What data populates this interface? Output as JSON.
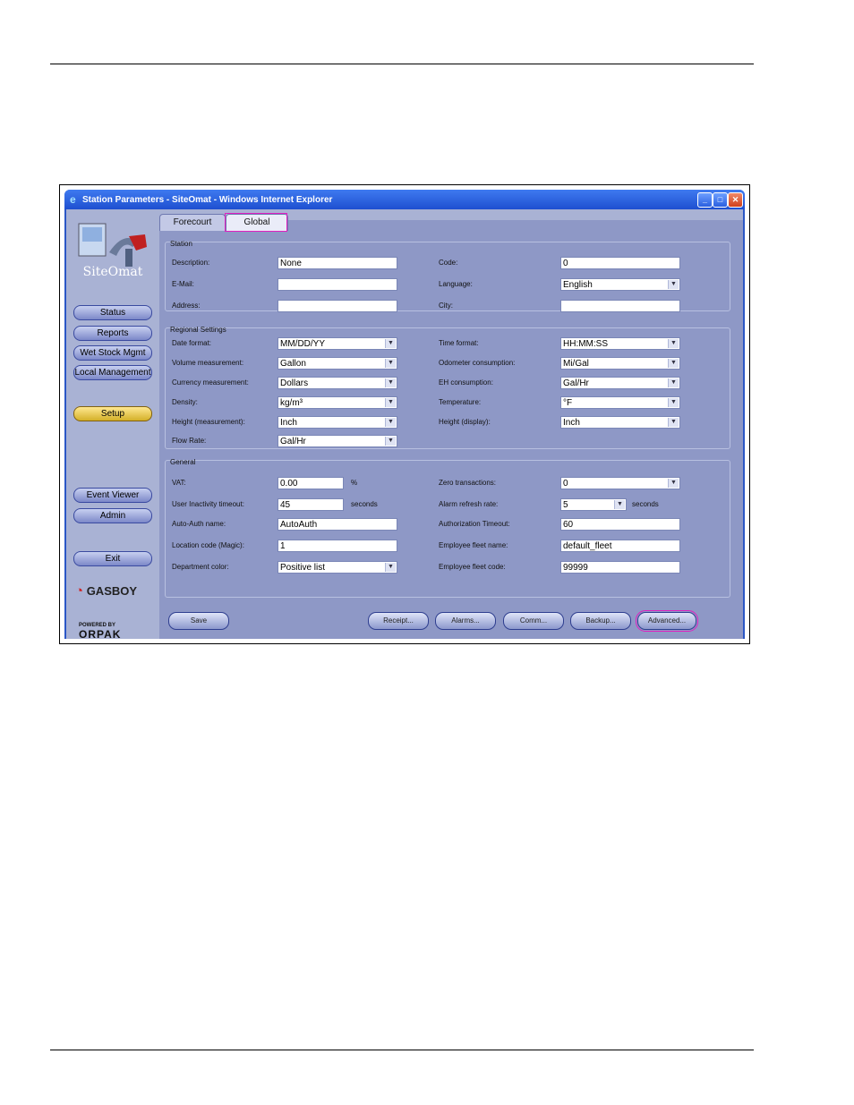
{
  "window": {
    "title": "Station Parameters - SiteOmat - Windows Internet Explorer"
  },
  "brand": "SiteOmat",
  "sidebar": {
    "items": [
      {
        "label": "Status"
      },
      {
        "label": "Reports"
      },
      {
        "label": "Wet Stock Mgmt"
      },
      {
        "label": "Local Management"
      },
      {
        "label": "Setup"
      },
      {
        "label": "Event Viewer"
      },
      {
        "label": "Admin"
      },
      {
        "label": "Exit"
      }
    ],
    "active": "Setup",
    "vendor": "GASBOY",
    "powered_by": "POWERED BY",
    "powered_name": "ORPAK"
  },
  "tabs": [
    {
      "label": "Forecourt"
    },
    {
      "label": "Global"
    }
  ],
  "selected_tab": "Global",
  "station": {
    "legend": "Station",
    "description_label": "Description:",
    "description": "None",
    "code_label": "Code:",
    "code": "0",
    "email_label": "E-Mail:",
    "email": "",
    "language_label": "Language:",
    "language": "English",
    "address_label": "Address:",
    "address": "",
    "city_label": "City:",
    "city": ""
  },
  "regional": {
    "legend": "Regional Settings",
    "date_format_label": "Date format:",
    "date_format": "MM/DD/YY",
    "time_format_label": "Time format:",
    "time_format": "HH:MM:SS",
    "volume_label": "Volume measurement:",
    "volume": "Gallon",
    "odometer_label": "Odometer consumption:",
    "odometer": "Mi/Gal",
    "currency_label": "Currency measurement:",
    "currency": "Dollars",
    "eh_label": "EH consumption:",
    "eh": "Gal/Hr",
    "density_label": "Density:",
    "density": "kg/m³",
    "temperature_label": "Temperature:",
    "temperature": "°F",
    "height_meas_label": "Height (measurement):",
    "height_meas": "Inch",
    "height_disp_label": "Height (display):",
    "height_disp": "Inch",
    "flow_label": "Flow Rate:",
    "flow": "Gal/Hr"
  },
  "general": {
    "legend": "General",
    "vat_label": "VAT:",
    "vat": "0.00",
    "vat_unit": "%",
    "zero_label": "Zero transactions:",
    "zero": "0",
    "inactivity_label": "User Inactivity timeout:",
    "inactivity": "45",
    "inactivity_unit": "seconds",
    "alarm_label": "Alarm refresh rate:",
    "alarm": "5",
    "alarm_unit": "seconds",
    "autoauth_label": "Auto-Auth name:",
    "autoauth": "AutoAuth",
    "authtimeout_label": "Authorization Timeout:",
    "authtimeout": "60",
    "location_label": "Location code (Magic):",
    "location": "1",
    "fleetname_label": "Employee fleet name:",
    "fleetname": "default_fleet",
    "dept_label": "Department color:",
    "dept": "Positive list",
    "fleetcode_label": "Employee fleet code:",
    "fleetcode": "99999"
  },
  "buttons": {
    "save": "Save",
    "receipt": "Receipt...",
    "alarms": "Alarms...",
    "comm": "Comm...",
    "backup": "Backup...",
    "advanced": "Advanced..."
  }
}
